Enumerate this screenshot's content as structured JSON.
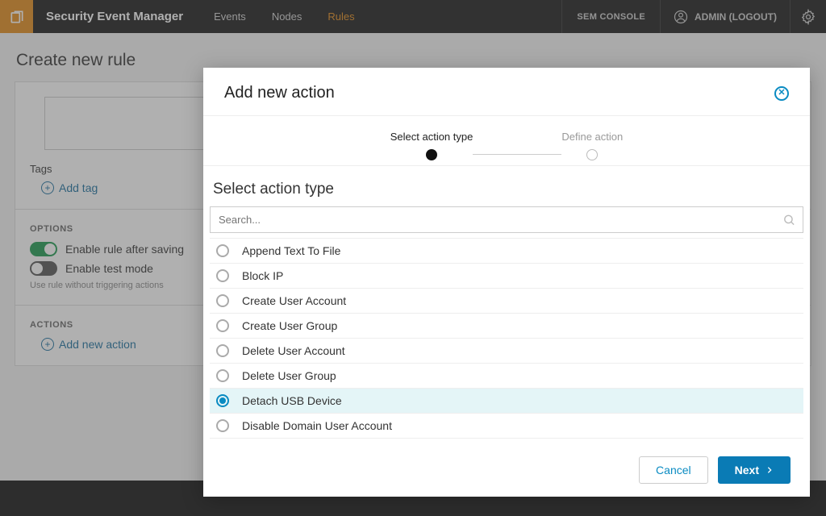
{
  "brand": "Security Event Manager",
  "nav": {
    "events": "Events",
    "nodes": "Nodes",
    "rules": "Rules"
  },
  "topright": {
    "console": "SEM CONSOLE",
    "user": "ADMIN (LOGOUT)"
  },
  "page": {
    "title": "Create new rule",
    "tags_label": "Tags",
    "add_tag": "Add tag",
    "options_head": "OPTIONS",
    "enable_after": "Enable rule after saving",
    "enable_test": "Enable test mode",
    "test_hint": "Use rule without triggering actions",
    "actions_head": "ACTIONS",
    "add_action": "Add new action"
  },
  "modal": {
    "title": "Add new action",
    "step1": "Select action type",
    "step2": "Define action",
    "section_title": "Select action type",
    "search_placeholder": "Search...",
    "selected": "Detach USB Device",
    "actions": [
      "Append Text To File",
      "Block IP",
      "Create User Account",
      "Create User Group",
      "Delete User Account",
      "Delete User Group",
      "Detach USB Device",
      "Disable Domain User Account"
    ],
    "cancel": "Cancel",
    "next": "Next"
  }
}
